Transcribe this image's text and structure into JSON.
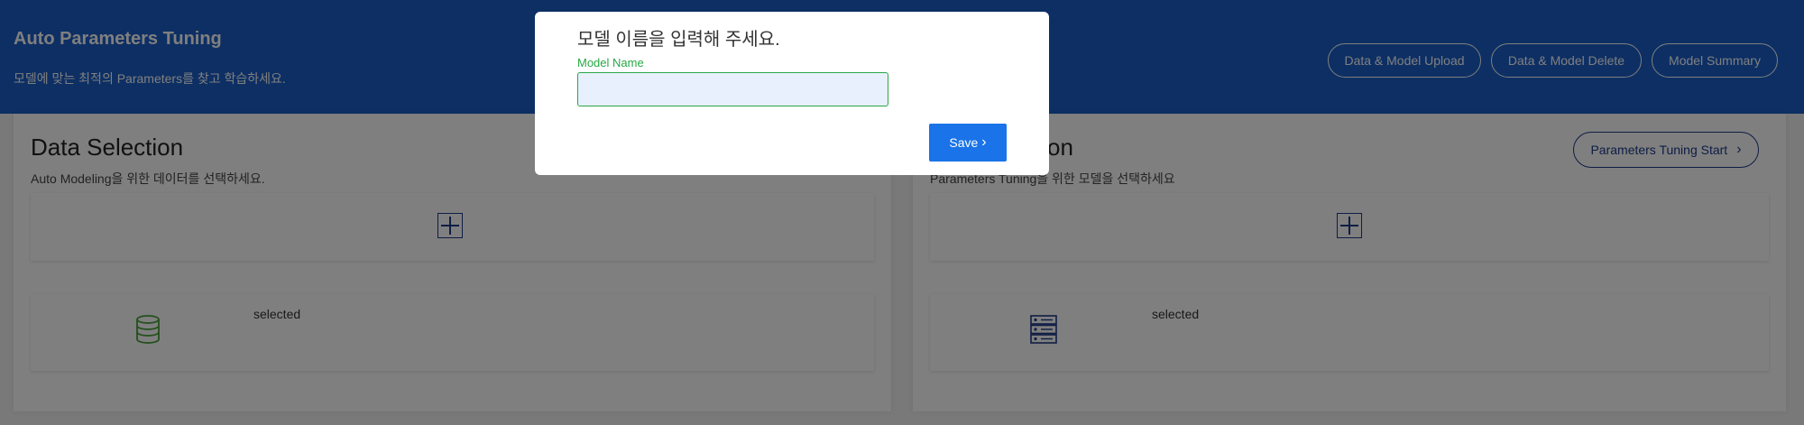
{
  "header": {
    "title": "Auto Parameters Tuning",
    "subtitle": "모델에 맞는 최적의 Parameters를 찾고 학습하세요.",
    "buttons": {
      "upload": "Data & Model Upload",
      "delete": "Data & Model Delete",
      "summary": "Model Summary"
    }
  },
  "left_panel": {
    "title": "Data Selection",
    "subtitle": "Auto Modeling을 위한 데이터를 선택하세요.",
    "add_icon": "plus-square-icon",
    "selected_icon": "database-icon",
    "selected_text": "selected"
  },
  "right_panel": {
    "title_partial": "ction",
    "subtitle_partial": "Parameters Tuning을 위한 모델을 선택하세요",
    "start_button": "Parameters Tuning Start",
    "add_icon": "plus-square-icon",
    "selected_icon": "server-icon",
    "selected_text": "selected"
  },
  "modal": {
    "title": "모델 이름을 입력해 주세요.",
    "field_label": "Model Name",
    "field_value": "",
    "save_label": "Save"
  },
  "colors": {
    "header_bg": "#1a5fc8",
    "accent_navy": "#1e3a8a",
    "save_blue": "#1a73e8",
    "input_green": "#28a745",
    "db_icon_green": "#4a9e3a"
  }
}
